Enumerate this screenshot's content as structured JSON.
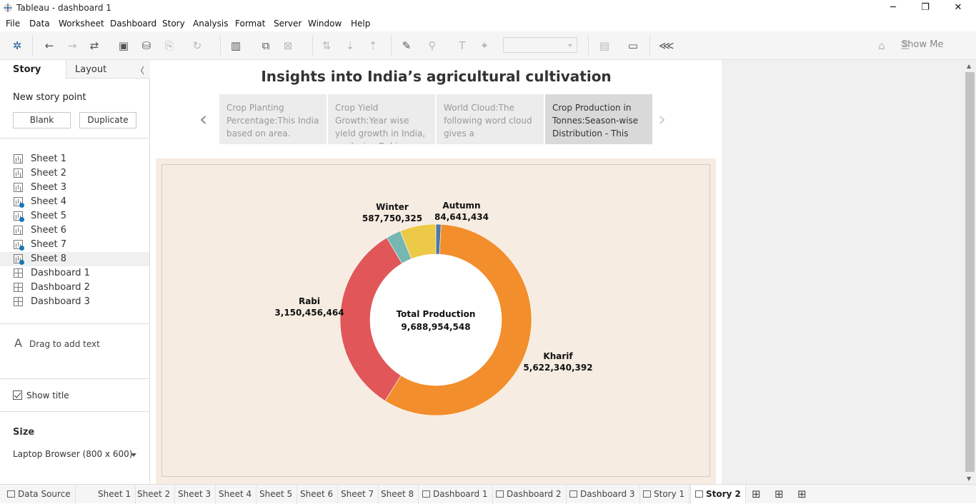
{
  "window": {
    "title": "Tableau - dashboard 1"
  },
  "menu": [
    "File",
    "Data",
    "Worksheet",
    "Dashboard",
    "Story",
    "Analysis",
    "Format",
    "Server",
    "Window",
    "Help"
  ],
  "toolbar": {
    "show_me": "Show Me"
  },
  "sidepanel": {
    "tab_story": "Story",
    "tab_layout": "Layout",
    "new_story_point": "New story point",
    "blank_button": "Blank",
    "duplicate_button": "Duplicate",
    "sheets": [
      {
        "label": "Sheet 1",
        "kind": "worksheet",
        "used": false
      },
      {
        "label": "Sheet 2",
        "kind": "worksheet",
        "used": false
      },
      {
        "label": "Sheet 3",
        "kind": "worksheet",
        "used": false
      },
      {
        "label": "Sheet 4",
        "kind": "worksheet",
        "used": true
      },
      {
        "label": "Sheet 5",
        "kind": "worksheet",
        "used": true
      },
      {
        "label": "Sheet 6",
        "kind": "worksheet",
        "used": false
      },
      {
        "label": "Sheet 7",
        "kind": "worksheet",
        "used": true
      },
      {
        "label": "Sheet 8",
        "kind": "worksheet",
        "used": true
      },
      {
        "label": "Dashboard 1",
        "kind": "dashboard",
        "used": false
      },
      {
        "label": "Dashboard 2",
        "kind": "dashboard",
        "used": false
      },
      {
        "label": "Dashboard 3",
        "kind": "dashboard",
        "used": false
      }
    ],
    "drag_text": "Drag to add text",
    "show_title": "Show title",
    "size_label": "Size",
    "size_value": "Laptop Browser (800 x 600)"
  },
  "story": {
    "title": "Insights into India’s agricultural cultivation",
    "captions": [
      {
        "text": "Crop Planting Percentage:This India based on area.",
        "selected": false
      },
      {
        "text": "Crop Yield Growth:Year wise yield growth in India, analyzing Rabi.",
        "selected": false
      },
      {
        "text": "World Cloud:The following word cloud gives a",
        "selected": false
      },
      {
        "text": "Crop Production in Tonnes:Season-wise Distribution - This",
        "selected": true
      }
    ]
  },
  "chart_data": {
    "type": "pie",
    "donut": true,
    "center_label": "Total Production",
    "center_value": "9,688,954,548",
    "slices": [
      {
        "name": "Autumn",
        "value": 84641434,
        "label": "84,641,434",
        "color": "#4e79a7"
      },
      {
        "name": "Kharif",
        "value": 5622340392,
        "label": "5,622,340,392",
        "color": "#f28e2b"
      },
      {
        "name": "Rabi",
        "value": 3150456464,
        "label": "3,150,456,464",
        "color": "#e15759"
      },
      {
        "name": "",
        "value": 243766933,
        "label": "",
        "color": "#76b7b2"
      },
      {
        "name": "Winter",
        "value": 587750325,
        "label": "587,750,325",
        "color": "#edc948"
      }
    ],
    "colors": {
      "background": "#f6ece2"
    }
  },
  "bottom_tabs": [
    {
      "label": "Data Source",
      "kind": "datasource",
      "active": false
    },
    {
      "label": "Sheet 1",
      "kind": "sheet",
      "active": false
    },
    {
      "label": "Sheet 2",
      "kind": "sheet",
      "active": false
    },
    {
      "label": "Sheet 3",
      "kind": "sheet",
      "active": false
    },
    {
      "label": "Sheet 4",
      "kind": "sheet",
      "active": false
    },
    {
      "label": "Sheet 5",
      "kind": "sheet",
      "active": false
    },
    {
      "label": "Sheet 6",
      "kind": "sheet",
      "active": false
    },
    {
      "label": "Sheet 7",
      "kind": "sheet",
      "active": false
    },
    {
      "label": "Sheet 8",
      "kind": "sheet",
      "active": false
    },
    {
      "label": "Dashboard 1",
      "kind": "dashboard",
      "active": false
    },
    {
      "label": "Dashboard 2",
      "kind": "dashboard",
      "active": false
    },
    {
      "label": "Dashboard 3",
      "kind": "dashboard",
      "active": false
    },
    {
      "label": "Story 1",
      "kind": "story",
      "active": false
    },
    {
      "label": "Story 2",
      "kind": "story",
      "active": true
    }
  ]
}
